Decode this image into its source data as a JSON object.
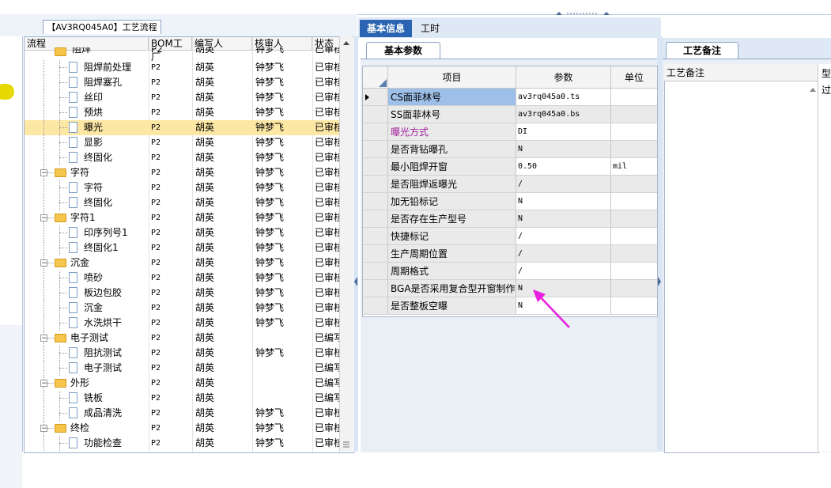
{
  "left_panel": {
    "tab_label": "【AV3RQ045A0】工艺流程",
    "columns": [
      "流程",
      "BOM工厂",
      "编写人",
      "核审人",
      "状态"
    ],
    "partial_top_row": {
      "name": "阻焊",
      "factory": "P2",
      "writer": "胡英",
      "reviewer": "钟梦飞",
      "status": "已审核"
    },
    "rows": [
      {
        "level": 2,
        "name": "阻焊前处理",
        "factory": "P2",
        "writer": "胡英",
        "reviewer": "钟梦飞",
        "status": "已审核",
        "selected": false
      },
      {
        "level": 2,
        "name": "阻焊塞孔",
        "factory": "P2",
        "writer": "胡英",
        "reviewer": "钟梦飞",
        "status": "已审核",
        "selected": false
      },
      {
        "level": 2,
        "name": "丝印",
        "factory": "P2",
        "writer": "胡英",
        "reviewer": "钟梦飞",
        "status": "已审核",
        "selected": false
      },
      {
        "level": 2,
        "name": "预烘",
        "factory": "P2",
        "writer": "胡英",
        "reviewer": "钟梦飞",
        "status": "已审核",
        "selected": false
      },
      {
        "level": 2,
        "name": "曝光",
        "factory": "P2",
        "writer": "胡英",
        "reviewer": "钟梦飞",
        "status": "已审核",
        "selected": true
      },
      {
        "level": 2,
        "name": "显影",
        "factory": "P2",
        "writer": "胡英",
        "reviewer": "钟梦飞",
        "status": "已审核",
        "selected": false
      },
      {
        "level": 2,
        "name": "终固化",
        "factory": "P2",
        "writer": "胡英",
        "reviewer": "钟梦飞",
        "status": "已审核",
        "selected": false
      },
      {
        "level": 1,
        "name": "字符",
        "factory": "P2",
        "writer": "胡英",
        "reviewer": "钟梦飞",
        "status": "已审核",
        "selected": false
      },
      {
        "level": 2,
        "name": "字符",
        "factory": "P2",
        "writer": "胡英",
        "reviewer": "钟梦飞",
        "status": "已审核",
        "selected": false
      },
      {
        "level": 2,
        "name": "终固化",
        "factory": "P2",
        "writer": "胡英",
        "reviewer": "钟梦飞",
        "status": "已审核",
        "selected": false
      },
      {
        "level": 1,
        "name": "字符1",
        "factory": "P2",
        "writer": "胡英",
        "reviewer": "钟梦飞",
        "status": "已审核",
        "selected": false
      },
      {
        "level": 2,
        "name": "印序列号1",
        "factory": "P2",
        "writer": "胡英",
        "reviewer": "钟梦飞",
        "status": "已审核",
        "selected": false
      },
      {
        "level": 2,
        "name": "终固化1",
        "factory": "P2",
        "writer": "胡英",
        "reviewer": "钟梦飞",
        "status": "已审核",
        "selected": false
      },
      {
        "level": 1,
        "name": "沉金",
        "factory": "P2",
        "writer": "胡英",
        "reviewer": "钟梦飞",
        "status": "已审核",
        "selected": false
      },
      {
        "level": 2,
        "name": "喷砂",
        "factory": "P2",
        "writer": "胡英",
        "reviewer": "钟梦飞",
        "status": "已审核",
        "selected": false
      },
      {
        "level": 2,
        "name": "板边包胶",
        "factory": "P2",
        "writer": "胡英",
        "reviewer": "钟梦飞",
        "status": "已审核",
        "selected": false
      },
      {
        "level": 2,
        "name": "沉金",
        "factory": "P2",
        "writer": "胡英",
        "reviewer": "钟梦飞",
        "status": "已审核",
        "selected": false
      },
      {
        "level": 2,
        "name": "水洗烘干",
        "factory": "P2",
        "writer": "胡英",
        "reviewer": "钟梦飞",
        "status": "已审核",
        "selected": false
      },
      {
        "level": 1,
        "name": "电子测试",
        "factory": "P2",
        "writer": "胡英",
        "reviewer": "",
        "status": "已编写",
        "selected": false
      },
      {
        "level": 2,
        "name": "阻抗测试",
        "factory": "P2",
        "writer": "胡英",
        "reviewer": "钟梦飞",
        "status": "已审核",
        "selected": false
      },
      {
        "level": 2,
        "name": "电子测试",
        "factory": "P2",
        "writer": "胡英",
        "reviewer": "",
        "status": "已编写",
        "selected": false
      },
      {
        "level": 1,
        "name": "外形",
        "factory": "P2",
        "writer": "胡英",
        "reviewer": "",
        "status": "已编写",
        "selected": false
      },
      {
        "level": 2,
        "name": "铣板",
        "factory": "P2",
        "writer": "胡英",
        "reviewer": "",
        "status": "已编写",
        "selected": false
      },
      {
        "level": 2,
        "name": "成品清洗",
        "factory": "P2",
        "writer": "胡英",
        "reviewer": "钟梦飞",
        "status": "已审核",
        "selected": false
      },
      {
        "level": 1,
        "name": "终检",
        "factory": "P2",
        "writer": "胡英",
        "reviewer": "钟梦飞",
        "status": "已审核",
        "selected": false
      },
      {
        "level": 2,
        "name": "功能检查",
        "factory": "P2",
        "writer": "胡英",
        "reviewer": "钟梦飞",
        "status": "已审核",
        "selected": false
      }
    ]
  },
  "middle_panel": {
    "tabs": [
      "基本信息",
      "工时"
    ],
    "sub_tab": "基本参数",
    "columns": [
      "项目",
      "参数",
      "单位"
    ],
    "rows": [
      {
        "name": "CS面菲林号",
        "value": "av3rq045a0.ts",
        "unit": "",
        "selected": true,
        "highlight": false
      },
      {
        "name": "SS面菲林号",
        "value": "av3rq045a0.bs",
        "unit": "",
        "selected": false,
        "highlight": false
      },
      {
        "name": "曝光方式",
        "value": "DI",
        "unit": "",
        "selected": false,
        "highlight": true
      },
      {
        "name": "是否背钻曝孔",
        "value": "N",
        "unit": "",
        "selected": false,
        "highlight": false
      },
      {
        "name": "最小阻焊开窗",
        "value": "0.50",
        "unit": "mil",
        "selected": false,
        "highlight": false
      },
      {
        "name": "是否阻焊返曝光",
        "value": "/",
        "unit": "",
        "selected": false,
        "highlight": false
      },
      {
        "name": "加无铅标记",
        "value": "N",
        "unit": "",
        "selected": false,
        "highlight": false
      },
      {
        "name": "是否存在生产型号",
        "value": "N",
        "unit": "",
        "selected": false,
        "highlight": false
      },
      {
        "name": "快捷标记",
        "value": "/",
        "unit": "",
        "selected": false,
        "highlight": false
      },
      {
        "name": "生产周期位置",
        "value": "/",
        "unit": "",
        "selected": false,
        "highlight": false
      },
      {
        "name": "周期格式",
        "value": "/",
        "unit": "",
        "selected": false,
        "highlight": false
      },
      {
        "name": "BGA是否采用复合型开窗制作",
        "value": "N",
        "unit": "",
        "selected": false,
        "highlight": false
      },
      {
        "name": "是否整板空曝",
        "value": "N",
        "unit": "",
        "selected": false,
        "highlight": false
      }
    ]
  },
  "right_panel": {
    "tab": "工艺备注",
    "column": "工艺备注",
    "partial_column": "型",
    "partial_text": "过"
  },
  "colors": {
    "tab_active": "#2a64b2",
    "selected_row": "#fde7a4",
    "selected_cell": "#9ec0e8",
    "highlight_text": "#a01a9b",
    "arrow": "#e81ee0"
  }
}
